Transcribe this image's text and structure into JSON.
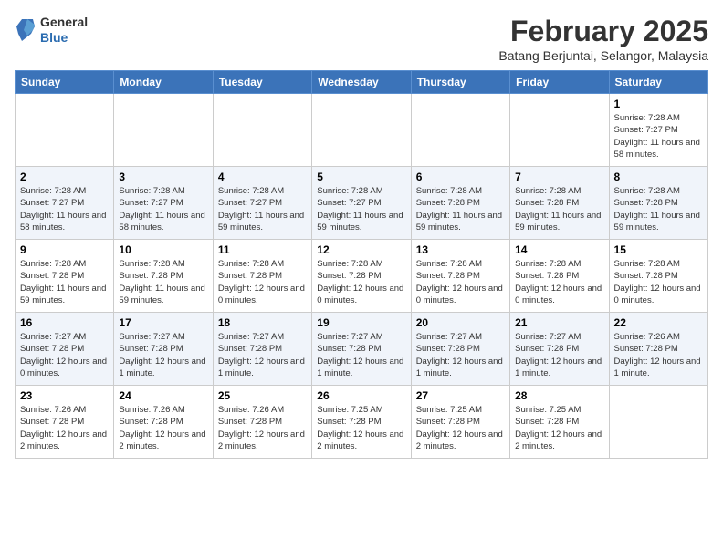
{
  "header": {
    "logo_general": "General",
    "logo_blue": "Blue",
    "month_title": "February 2025",
    "location": "Batang Berjuntai, Selangor, Malaysia"
  },
  "days_of_week": [
    "Sunday",
    "Monday",
    "Tuesday",
    "Wednesday",
    "Thursday",
    "Friday",
    "Saturday"
  ],
  "weeks": [
    {
      "days": [
        {
          "num": "",
          "detail": ""
        },
        {
          "num": "",
          "detail": ""
        },
        {
          "num": "",
          "detail": ""
        },
        {
          "num": "",
          "detail": ""
        },
        {
          "num": "",
          "detail": ""
        },
        {
          "num": "",
          "detail": ""
        },
        {
          "num": "1",
          "detail": "Sunrise: 7:28 AM\nSunset: 7:27 PM\nDaylight: 11 hours and 58 minutes."
        }
      ]
    },
    {
      "days": [
        {
          "num": "2",
          "detail": "Sunrise: 7:28 AM\nSunset: 7:27 PM\nDaylight: 11 hours and 58 minutes."
        },
        {
          "num": "3",
          "detail": "Sunrise: 7:28 AM\nSunset: 7:27 PM\nDaylight: 11 hours and 58 minutes."
        },
        {
          "num": "4",
          "detail": "Sunrise: 7:28 AM\nSunset: 7:27 PM\nDaylight: 11 hours and 59 minutes."
        },
        {
          "num": "5",
          "detail": "Sunrise: 7:28 AM\nSunset: 7:27 PM\nDaylight: 11 hours and 59 minutes."
        },
        {
          "num": "6",
          "detail": "Sunrise: 7:28 AM\nSunset: 7:28 PM\nDaylight: 11 hours and 59 minutes."
        },
        {
          "num": "7",
          "detail": "Sunrise: 7:28 AM\nSunset: 7:28 PM\nDaylight: 11 hours and 59 minutes."
        },
        {
          "num": "8",
          "detail": "Sunrise: 7:28 AM\nSunset: 7:28 PM\nDaylight: 11 hours and 59 minutes."
        }
      ]
    },
    {
      "days": [
        {
          "num": "9",
          "detail": "Sunrise: 7:28 AM\nSunset: 7:28 PM\nDaylight: 11 hours and 59 minutes."
        },
        {
          "num": "10",
          "detail": "Sunrise: 7:28 AM\nSunset: 7:28 PM\nDaylight: 11 hours and 59 minutes."
        },
        {
          "num": "11",
          "detail": "Sunrise: 7:28 AM\nSunset: 7:28 PM\nDaylight: 12 hours and 0 minutes."
        },
        {
          "num": "12",
          "detail": "Sunrise: 7:28 AM\nSunset: 7:28 PM\nDaylight: 12 hours and 0 minutes."
        },
        {
          "num": "13",
          "detail": "Sunrise: 7:28 AM\nSunset: 7:28 PM\nDaylight: 12 hours and 0 minutes."
        },
        {
          "num": "14",
          "detail": "Sunrise: 7:28 AM\nSunset: 7:28 PM\nDaylight: 12 hours and 0 minutes."
        },
        {
          "num": "15",
          "detail": "Sunrise: 7:28 AM\nSunset: 7:28 PM\nDaylight: 12 hours and 0 minutes."
        }
      ]
    },
    {
      "days": [
        {
          "num": "16",
          "detail": "Sunrise: 7:27 AM\nSunset: 7:28 PM\nDaylight: 12 hours and 0 minutes."
        },
        {
          "num": "17",
          "detail": "Sunrise: 7:27 AM\nSunset: 7:28 PM\nDaylight: 12 hours and 1 minute."
        },
        {
          "num": "18",
          "detail": "Sunrise: 7:27 AM\nSunset: 7:28 PM\nDaylight: 12 hours and 1 minute."
        },
        {
          "num": "19",
          "detail": "Sunrise: 7:27 AM\nSunset: 7:28 PM\nDaylight: 12 hours and 1 minute."
        },
        {
          "num": "20",
          "detail": "Sunrise: 7:27 AM\nSunset: 7:28 PM\nDaylight: 12 hours and 1 minute."
        },
        {
          "num": "21",
          "detail": "Sunrise: 7:27 AM\nSunset: 7:28 PM\nDaylight: 12 hours and 1 minute."
        },
        {
          "num": "22",
          "detail": "Sunrise: 7:26 AM\nSunset: 7:28 PM\nDaylight: 12 hours and 1 minute."
        }
      ]
    },
    {
      "days": [
        {
          "num": "23",
          "detail": "Sunrise: 7:26 AM\nSunset: 7:28 PM\nDaylight: 12 hours and 2 minutes."
        },
        {
          "num": "24",
          "detail": "Sunrise: 7:26 AM\nSunset: 7:28 PM\nDaylight: 12 hours and 2 minutes."
        },
        {
          "num": "25",
          "detail": "Sunrise: 7:26 AM\nSunset: 7:28 PM\nDaylight: 12 hours and 2 minutes."
        },
        {
          "num": "26",
          "detail": "Sunrise: 7:25 AM\nSunset: 7:28 PM\nDaylight: 12 hours and 2 minutes."
        },
        {
          "num": "27",
          "detail": "Sunrise: 7:25 AM\nSunset: 7:28 PM\nDaylight: 12 hours and 2 minutes."
        },
        {
          "num": "28",
          "detail": "Sunrise: 7:25 AM\nSunset: 7:28 PM\nDaylight: 12 hours and 2 minutes."
        },
        {
          "num": "",
          "detail": ""
        }
      ]
    }
  ]
}
